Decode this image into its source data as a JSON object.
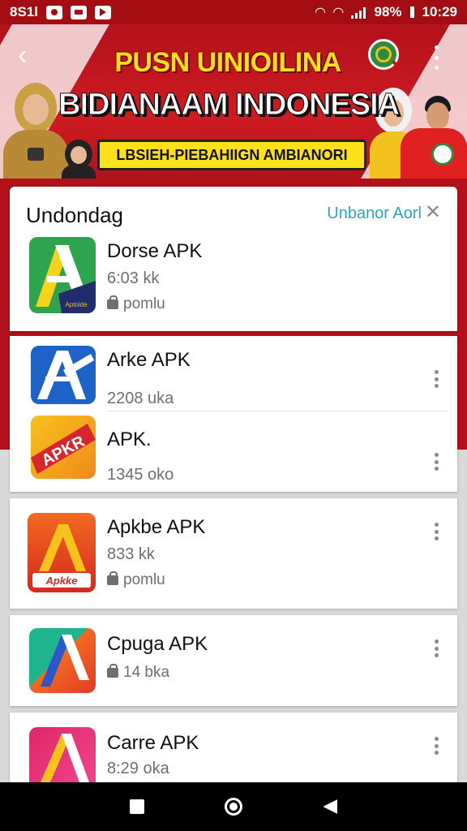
{
  "status_bar": {
    "time_left": "8S1l",
    "battery": "98%",
    "time": "10:29"
  },
  "header": {
    "headline_1": "PUSN UINIOILINA",
    "headline_2": "BIDIANAAM INDONESIA",
    "tagline": "LBSIEH-PIEBAHIIGN AMBIANORI",
    "colors": {
      "primary": "#c8161d",
      "accent": "#ffe11a"
    }
  },
  "download_section": {
    "title": "Undondag",
    "action": "Unbanor Aorl",
    "apps": [
      {
        "name": "Dorse APK",
        "size": "6:03 kk",
        "meta": "pomlu"
      }
    ]
  },
  "app_list": [
    {
      "name": "Arke APK",
      "size": "2208 uka"
    },
    {
      "name": "APK.",
      "size": "1345 oko"
    },
    {
      "name": "Apkbe APK",
      "size": "833 kk",
      "meta": "pomlu"
    },
    {
      "name": "Cpuga APK",
      "size": "14 bka"
    },
    {
      "name": "Carre APK",
      "size": "8:29 oka"
    }
  ],
  "app_icon_labels": {
    "dorse": "Aptoide",
    "arke": "APKR",
    "apkbe": "Apkke"
  }
}
